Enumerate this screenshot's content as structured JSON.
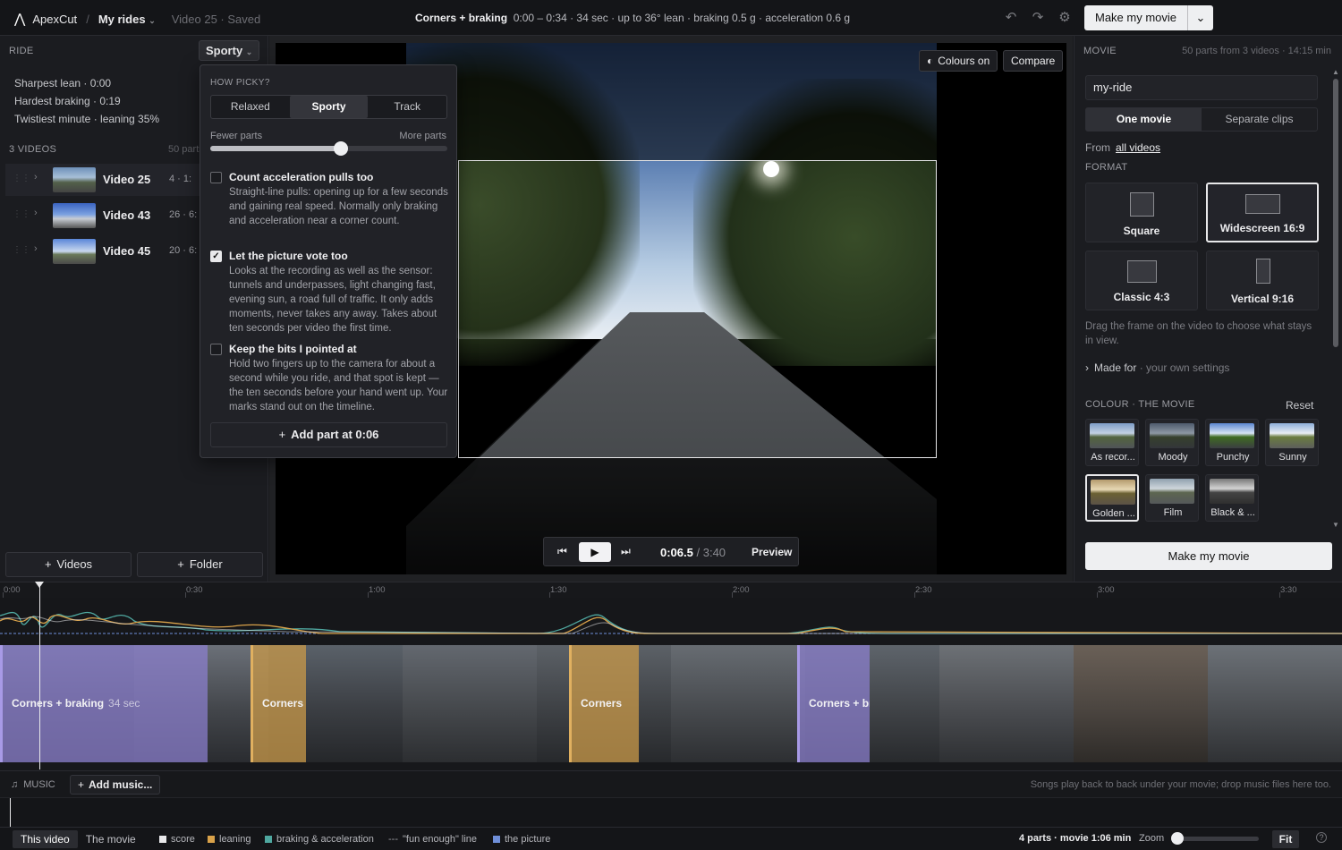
{
  "app": {
    "name": "ApexCut",
    "crumb": "My rides",
    "context": "Video 25 · Saved",
    "summary_title": "Corners + braking",
    "summary_text": "0:00 – 0:34 · 34 sec · up to 36° lean · braking 0.5 g · acceleration 0.6 g",
    "make_label": "Make my movie"
  },
  "ride": {
    "header": "RIDE",
    "preset": "Sporty",
    "stats": [
      "Sharpest lean · 0:00",
      "Hardest braking · 0:19",
      "Twistiest minute · leaning 35%"
    ],
    "videos_header": "3 VIDEOS",
    "videos_count": "50 parts",
    "videos": [
      {
        "name": "Video 25",
        "meta": "4 · 1:"
      },
      {
        "name": "Video 43",
        "meta": "26 · 6:"
      },
      {
        "name": "Video 45",
        "meta": "20 · 6:"
      }
    ],
    "add_videos": "Videos",
    "add_folder": "Folder"
  },
  "picky": {
    "header": "HOW PICKY?",
    "levels": [
      "Relaxed",
      "Sporty",
      "Track"
    ],
    "selected": "Sporty",
    "fewer": "Fewer parts",
    "more": "More parts",
    "slider_value": 0.55,
    "options": [
      {
        "title": "Count acceleration pulls too",
        "checked": false,
        "desc": "Straight-line pulls: opening up for a few seconds and gaining real speed. Normally only braking and acceleration near a corner count."
      },
      {
        "title": "Let the picture vote too",
        "checked": true,
        "desc": "Looks at the recording as well as the sensor: tunnels and underpasses, light changing fast, evening sun, a road full of traffic. It only adds moments, never takes any away. Takes about ten seconds per video the first time."
      },
      {
        "title": "Keep the bits I pointed at",
        "checked": false,
        "desc": "Hold two fingers up to the camera for about a second while you ride, and that spot is kept — the ten seconds before your hand went up. Your marks stand out on the timeline."
      }
    ],
    "add_part": "Add part at 0:06"
  },
  "viewer": {
    "colours_btn": "Colours on",
    "compare_btn": "Compare",
    "time": "0:06.5",
    "total": "/ 3:40",
    "preview": "Preview"
  },
  "movie": {
    "header": "MOVIE",
    "meta": "50 parts from 3 videos · 14:15 min",
    "name": "my-ride",
    "modes": [
      "One movie",
      "Separate clips"
    ],
    "from_label": "From",
    "from_link": "all videos",
    "format_header": "FORMAT",
    "formats": [
      "Square",
      "Widescreen 16:9",
      "Classic 4:3",
      "Vertical 9:16"
    ],
    "format_selected": "Widescreen 16:9",
    "drag_hint": "Drag the frame on the video to choose what stays in view.",
    "made_for": "Made for",
    "made_for_value": "· your own settings",
    "colour_header": "COLOUR · THE MOVIE",
    "reset": "Reset",
    "looks": [
      "As recor...",
      "Moody",
      "Punchy",
      "Sunny",
      "Golden ...",
      "Film",
      "Black & ..."
    ],
    "look_selected": "Golden ...",
    "make_label": "Make my movie"
  },
  "timeline": {
    "ticks": [
      "0:00",
      "0:30",
      "1:00",
      "1:30",
      "2:00",
      "2:30",
      "3:00",
      "3:30"
    ],
    "parts": [
      {
        "label": "Corners + braking",
        "dur": "34 sec",
        "kind": "braking"
      },
      {
        "label": "Corners",
        "dur": "",
        "kind": "corner"
      },
      {
        "label": "Corners",
        "dur": "",
        "kind": "corner"
      },
      {
        "label": "Corners + br",
        "dur": "",
        "kind": "braking"
      }
    ],
    "music_header": "MUSIC",
    "add_music": "Add music...",
    "music_hint": "Songs play back to back under your movie; drop music files here too."
  },
  "footer": {
    "views": [
      "This video",
      "The movie"
    ],
    "view_selected": "This video",
    "legend": [
      {
        "label": "score",
        "color": "#e8e8ea"
      },
      {
        "label": "leaning",
        "color": "#d9a24a"
      },
      {
        "label": "braking & acceleration",
        "color": "#4fa8a0"
      },
      {
        "label": "\"fun enough\" line",
        "color": "#9a9ba1"
      },
      {
        "label": "the picture",
        "color": "#6f8fd9"
      }
    ],
    "stats": "4 parts · movie 1:06 min",
    "zoom": "Zoom",
    "fit": "Fit",
    "help": "?"
  },
  "colors": {
    "braking_part": "#8c7fd0",
    "corner_part": "#c99a4a"
  }
}
